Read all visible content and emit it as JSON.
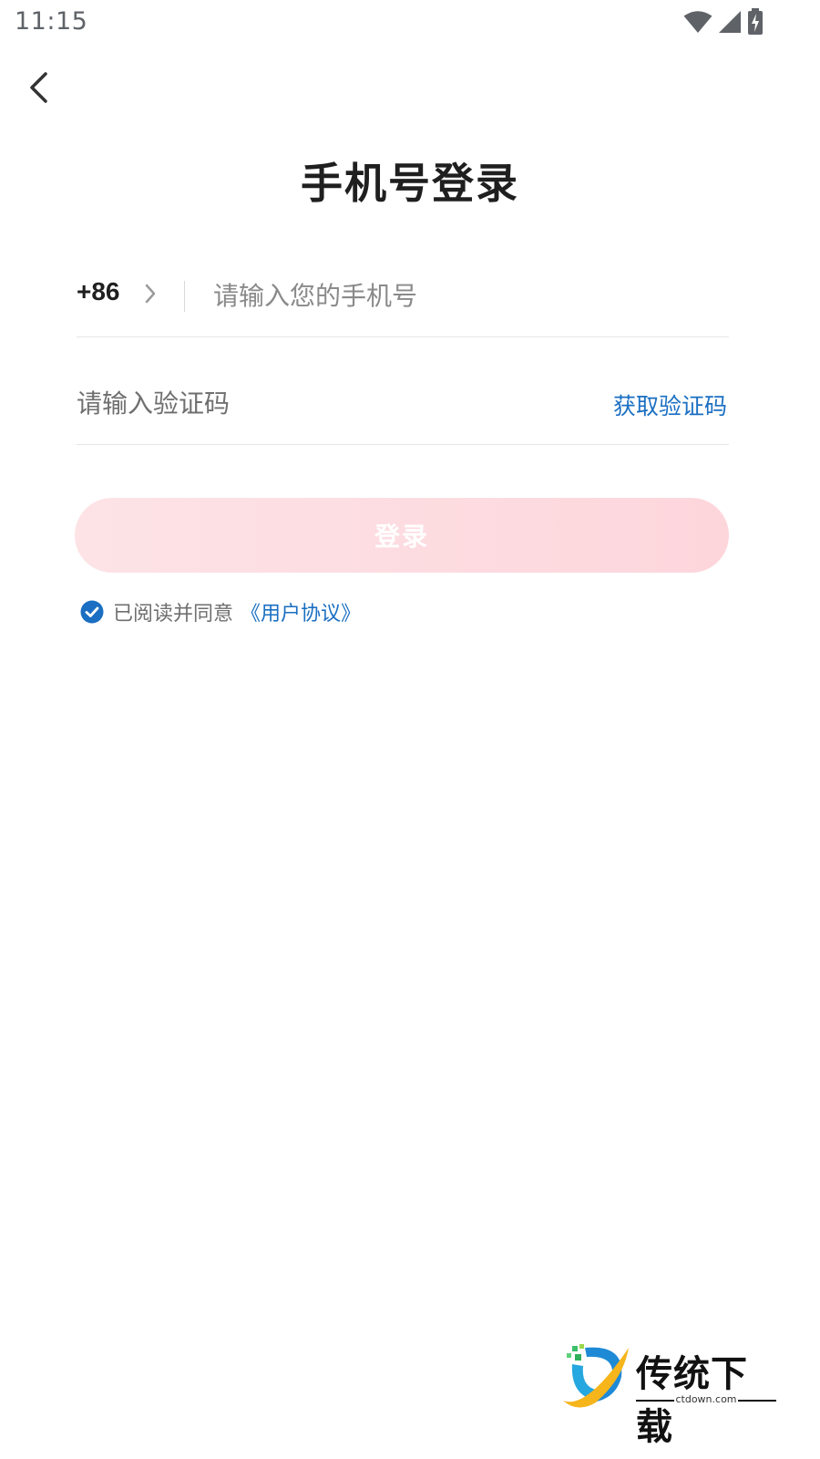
{
  "status_bar": {
    "time": "11:15",
    "icons": [
      "wifi-icon",
      "cell-signal-icon",
      "battery-charging-icon"
    ]
  },
  "nav": {
    "back_icon": "chevron-left-icon"
  },
  "title": "手机号登录",
  "phone": {
    "country_code": "+86",
    "placeholder": "请输入您的手机号",
    "value": ""
  },
  "code": {
    "placeholder": "请输入验证码",
    "value": "",
    "get_code_label": "获取验证码"
  },
  "login_button": "登录",
  "agreement": {
    "checked": true,
    "text": "已阅读并同意",
    "link": "《用户协议》"
  },
  "colors": {
    "accent": "#1a6fc2",
    "button_bg": "#fdd9de",
    "title": "#1f1f1f"
  },
  "watermark": {
    "title": "传统下载",
    "subtitle": "ctdown.com"
  }
}
